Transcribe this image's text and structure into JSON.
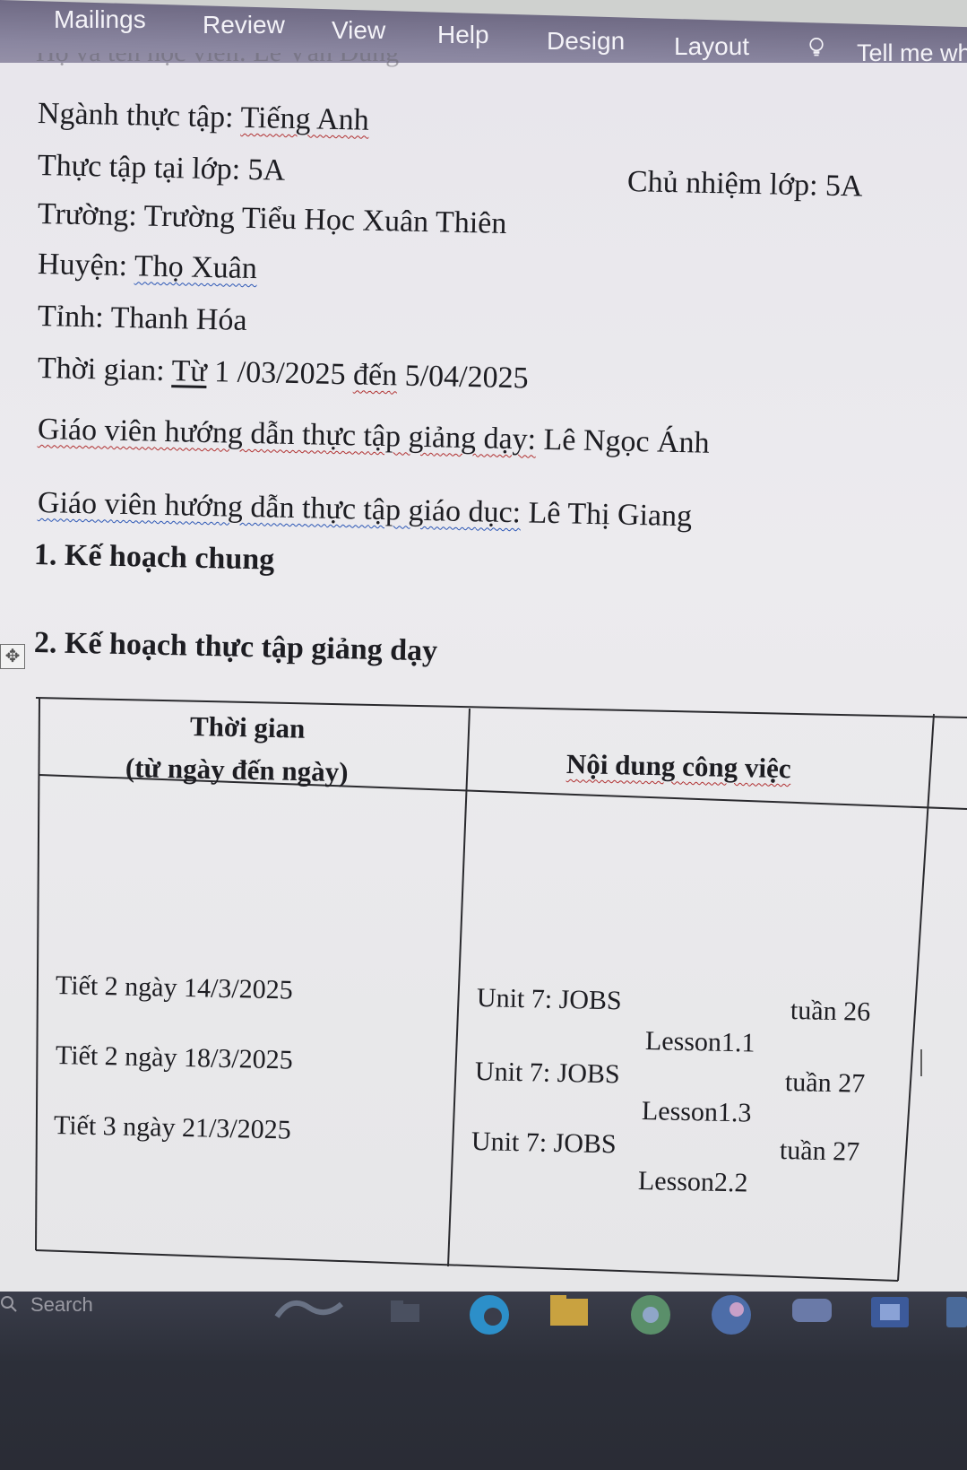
{
  "ribbon": {
    "tabs": [
      "Mailings",
      "Review",
      "View",
      "Help",
      "Design",
      "Layout"
    ],
    "tell_me": "Tell me wh"
  },
  "document": {
    "cut_off_line": "Họ và tên học viên: Lê Văn Dũng",
    "major_label": "Ngành thực tập:",
    "major_value": "Tiếng Anh",
    "class_label": "Thực tập tại lớp: 5A",
    "homeroom": "Chủ nhiệm lớp: 5A",
    "school_label": "Trường:",
    "school_value": "Trường Tiểu Học Xuân Thiên",
    "district_label": "Huyện:",
    "district_value": "Thọ Xuân",
    "province": "Tỉnh: Thanh Hóa",
    "time_label": "Thời gian:",
    "time_from": "Từ",
    "time_range": " 1 /03/2025",
    "time_to": "đến",
    "time_end": "5/04/2025",
    "teaching_mentor_label": "Giáo viên hướng dẫn thực tập giảng dạy:",
    "teaching_mentor": " Lê Ngọc Ánh",
    "education_mentor_label": "Giáo viên hướng dẫn thực tập giáo dục:",
    "education_mentor": " Lê Thị Giang",
    "section1": "1. Kế hoạch chung",
    "section2": "2. Kế hoạch thực tập giảng dạy"
  },
  "table": {
    "headers": {
      "time_line1": "Thời gian",
      "time_line2": "(từ ngày đến ngày)",
      "content": "Nội dung công việc"
    },
    "rows": [
      {
        "time": "Tiết 2 ngày 14/3/2025",
        "unit": "Unit 7: JOBS",
        "week": "tuần 26",
        "lesson": "Lesson1.1"
      },
      {
        "time": "Tiết 2 ngày 18/3/2025",
        "unit": "Unit 7: JOBS",
        "week": "tuần 27",
        "lesson": "Lesson1.3"
      },
      {
        "time": "Tiết 3 ngày 21/3/2025",
        "unit": "Unit 7: JOBS",
        "week": "tuần 27",
        "lesson": "Lesson2.2"
      }
    ]
  },
  "taskbar": {
    "search_placeholder": "Search"
  }
}
